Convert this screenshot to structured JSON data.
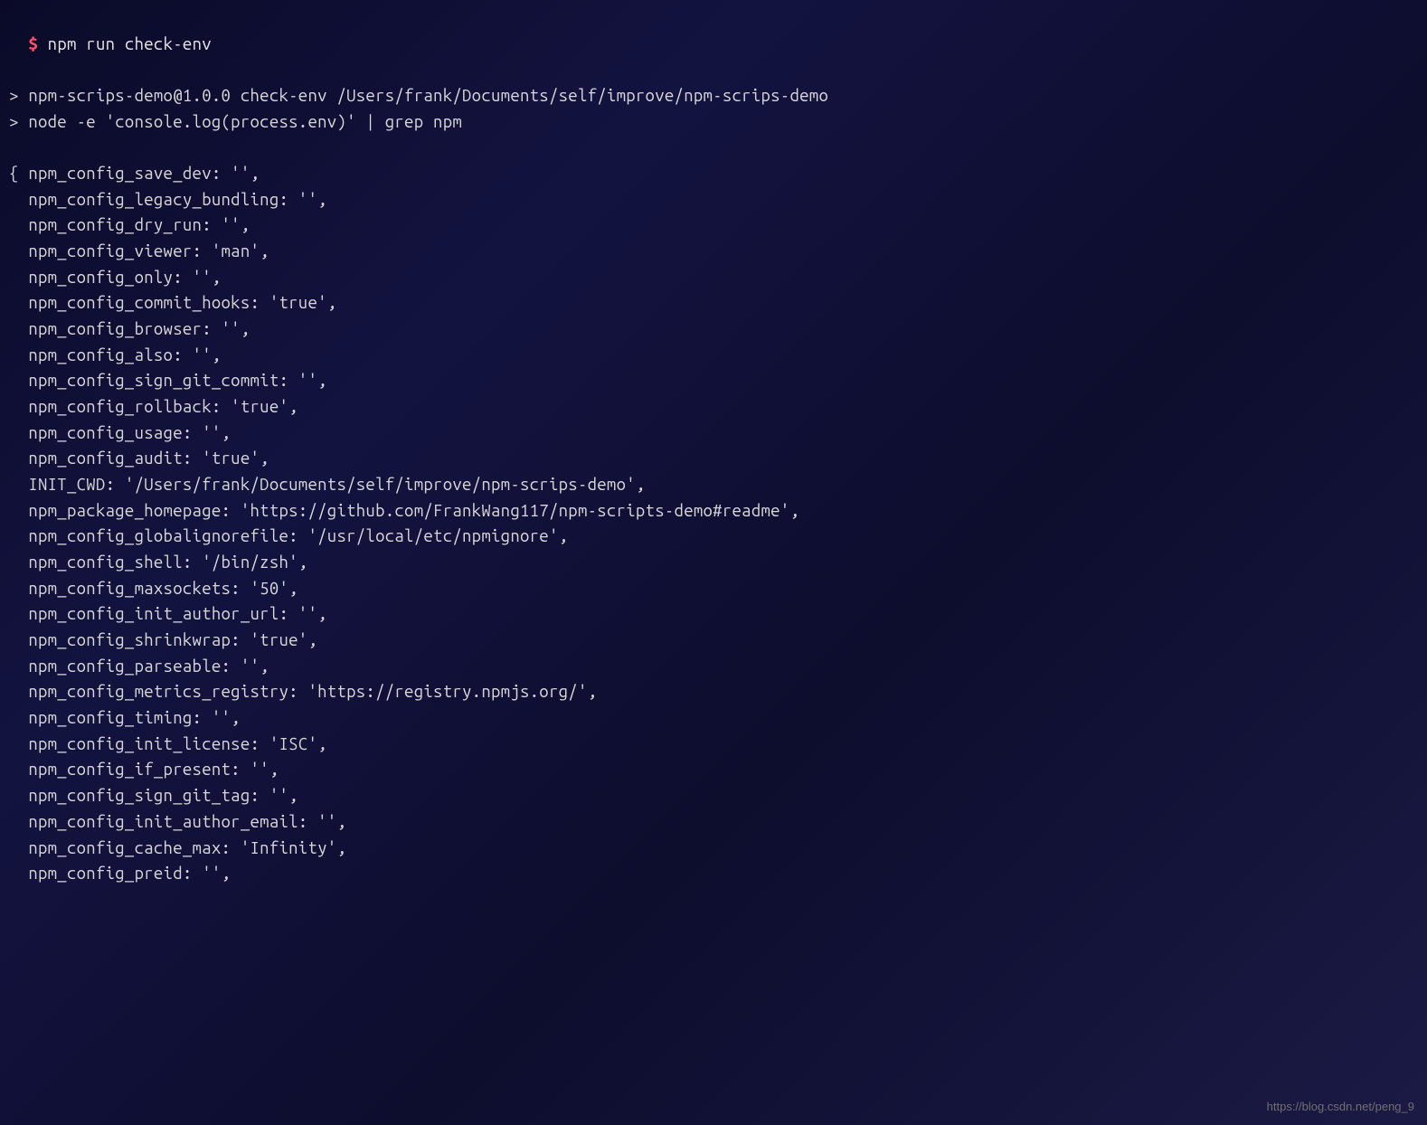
{
  "prompt": {
    "symbol": "$",
    "command": "npm run check-env"
  },
  "header_lines": [
    "> npm-scrips-demo@1.0.0 check-env /Users/frank/Documents/self/improve/npm-scrips-demo",
    "> node -e 'console.log(process.env)' | grep npm"
  ],
  "env_lines": [
    "{ npm_config_save_dev: '',",
    "  npm_config_legacy_bundling: '',",
    "  npm_config_dry_run: '',",
    "  npm_config_viewer: 'man',",
    "  npm_config_only: '',",
    "  npm_config_commit_hooks: 'true',",
    "  npm_config_browser: '',",
    "  npm_config_also: '',",
    "  npm_config_sign_git_commit: '',",
    "  npm_config_rollback: 'true',",
    "  npm_config_usage: '',",
    "  npm_config_audit: 'true',",
    "  INIT_CWD: '/Users/frank/Documents/self/improve/npm-scrips-demo',",
    "  npm_package_homepage: 'https://github.com/FrankWang117/npm-scripts-demo#readme',",
    "  npm_config_globalignorefile: '/usr/local/etc/npmignore',",
    "  npm_config_shell: '/bin/zsh',",
    "  npm_config_maxsockets: '50',",
    "  npm_config_init_author_url: '',",
    "  npm_config_shrinkwrap: 'true',",
    "  npm_config_parseable: '',",
    "  npm_config_metrics_registry: 'https://registry.npmjs.org/',",
    "  npm_config_timing: '',",
    "  npm_config_init_license: 'ISC',",
    "  npm_config_if_present: '',",
    "  npm_config_sign_git_tag: '',",
    "  npm_config_init_author_email: '',",
    "  npm_config_cache_max: 'Infinity',",
    "  npm_config_preid: '',"
  ],
  "watermark": "https://blog.csdn.net/peng_9"
}
